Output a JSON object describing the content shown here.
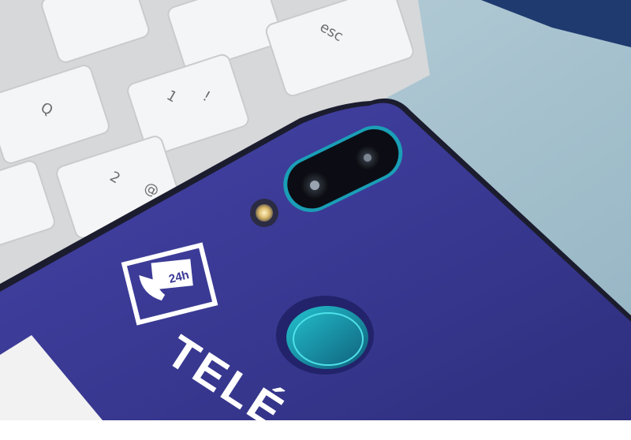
{
  "scene": {
    "description_free": true,
    "colors": {
      "background": "#a6c2cf",
      "keyboard_frame": "#d7d9db",
      "key": "#f3f4f5",
      "phone_back": "#3a3896",
      "camera_ring": "#17b4c4",
      "fingerprint_ring": "#15a6b4"
    }
  },
  "phone": {
    "badge_label": "24h",
    "brand_text": "TELÉ"
  },
  "keyboard": {
    "keys": [
      {
        "label": "esc"
      },
      {
        "label": "Q"
      },
      {
        "label": "1"
      },
      {
        "label": "!"
      },
      {
        "label": "2"
      },
      {
        "label": "@"
      }
    ]
  },
  "camera": {
    "icon": "dual-camera-icon",
    "flash_icon": "flash-icon",
    "fingerprint_icon": "fingerprint-sensor-icon"
  }
}
